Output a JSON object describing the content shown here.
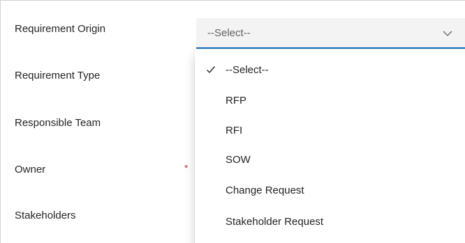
{
  "form": {
    "fields": [
      {
        "label": "Requirement Origin"
      },
      {
        "label": "Requirement Type"
      },
      {
        "label": "Responsible Team"
      },
      {
        "label": "Owner",
        "required_mark": "*"
      },
      {
        "label": "Stakeholders"
      }
    ]
  },
  "requirement_origin_select": {
    "value": "--Select--",
    "chevron_icon": "chevron-down-icon",
    "accent_color": "#0f6cbd"
  },
  "dropdown": {
    "selected_icon": "checkmark-icon",
    "options": [
      {
        "label": "--Select--",
        "selected": true
      },
      {
        "label": "RFP",
        "selected": false
      },
      {
        "label": "RFI",
        "selected": false
      },
      {
        "label": "SOW",
        "selected": false
      },
      {
        "label": "Change Request",
        "selected": false
      },
      {
        "label": "Stakeholder Request",
        "selected": false
      }
    ]
  }
}
